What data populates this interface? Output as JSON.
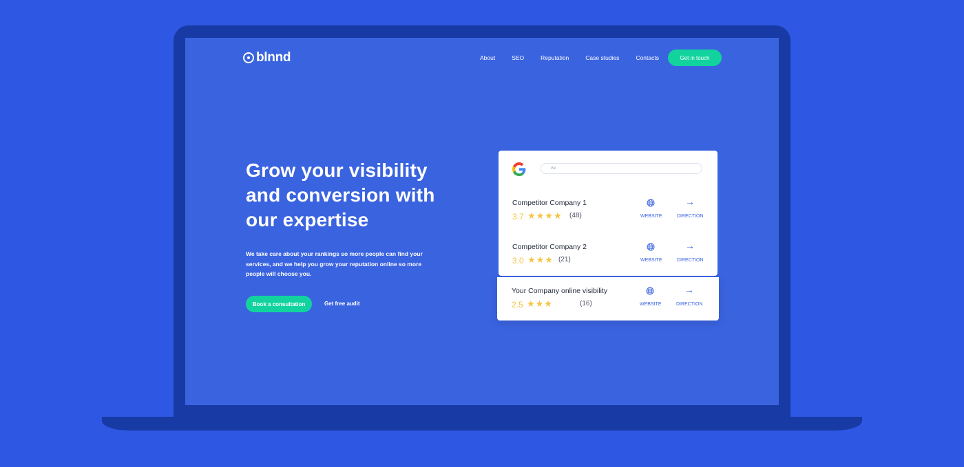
{
  "header": {
    "logo_text": "blnnd",
    "nav": [
      "About",
      "SEO",
      "Reputation",
      "Case studies",
      "Contacts"
    ],
    "cta": "Get in touch"
  },
  "hero": {
    "title": "Grow your visibility and conversion with our expertise",
    "description": "We take care about your rankings so more people can find your services, and we help you grow your reputation online so more people will choose you.",
    "primary_button": "Book a consultation",
    "secondary_button": "Get free audit"
  },
  "google_card": {
    "search_placeholder": "We",
    "listings": [
      {
        "name": "Competitor Company 1",
        "rating": "3.7",
        "stars": 4,
        "reviews": "(48)",
        "website_label": "WEBSITE",
        "direction_label": "DIRECTION"
      },
      {
        "name": "Competitor Company 2",
        "rating": "3.0",
        "stars": 3,
        "reviews": "(21)",
        "website_label": "WEBSITE",
        "direction_label": "DIRECTION"
      }
    ],
    "your_company": {
      "name": "Your Company online visibility",
      "rating": "2.5",
      "stars": 3,
      "reviews": "(16)",
      "website_label": "WEBSITE",
      "direction_label": "DIRECTION"
    }
  },
  "colors": {
    "background": "#2e57e3",
    "screen": "#3a63e0",
    "frame": "#173aa5",
    "accent": "#12d39e",
    "star": "#f4c542"
  }
}
